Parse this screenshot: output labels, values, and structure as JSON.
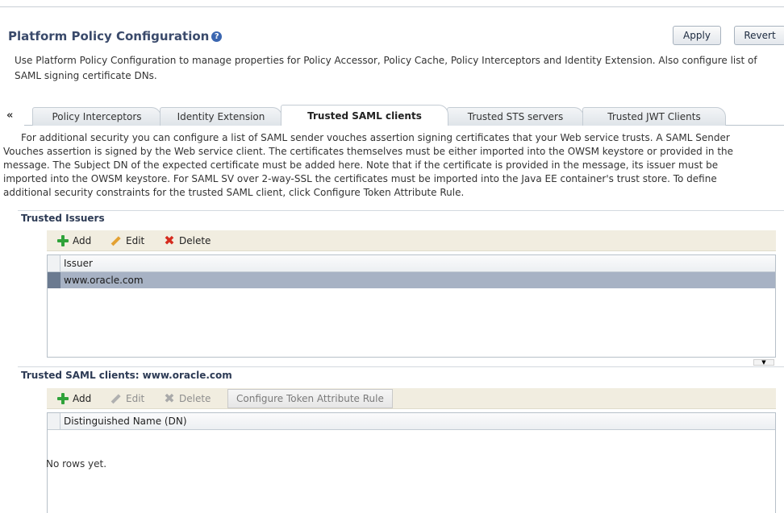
{
  "page": {
    "title": "Platform Policy Configuration",
    "apply_label": "Apply",
    "revert_label": "Revert",
    "intro_line1": "Use Platform Policy Configuration to manage properties for Policy Accessor, Policy Cache, Policy Interceptors and Identity Extension. Also configure list of",
    "intro_line2": "SAML signing certificate DNs."
  },
  "tabs": {
    "prev_label": "«",
    "items": [
      {
        "label": "Policy Interceptors"
      },
      {
        "label": "Identity Extension"
      },
      {
        "label": "Trusted SAML clients"
      },
      {
        "label": "Trusted STS servers"
      },
      {
        "label": "Trusted JWT Clients"
      }
    ]
  },
  "description": [
    "For additional security you can configure a list of SAML sender vouches assertion signing certificates that your Web service trusts. A SAML Sender",
    "Vouches assertion is signed by the Web service client. The certificates themselves must be either imported into the OWSM keystore or provided in the",
    "message. The Subject DN of the expected certificate must be added here. Note that if the certificate is provided in the message, its issuer must be",
    "imported into the OWSM keystore. For SAML SV over 2-way-SSL the certificates must be imported into the Java EE container's trust store. To define",
    "additional security constraints for the trusted SAML client, click Configure Token Attribute Rule."
  ],
  "issuers": {
    "title": "Trusted Issuers",
    "add_label": "Add",
    "edit_label": "Edit",
    "delete_label": "Delete",
    "column": "Issuer",
    "rows": [
      "www.oracle.com"
    ]
  },
  "clients": {
    "title": "Trusted SAML clients: www.oracle.com",
    "add_label": "Add",
    "edit_label": "Edit",
    "delete_label": "Delete",
    "configure_label": "Configure Token Attribute Rule",
    "column": "Distinguished Name (DN)",
    "empty_text": "No rows yet."
  },
  "colors": {
    "title": "#3a4a6b",
    "selected_row": "#a7b2c4",
    "toolbar": "#f1ede0"
  }
}
